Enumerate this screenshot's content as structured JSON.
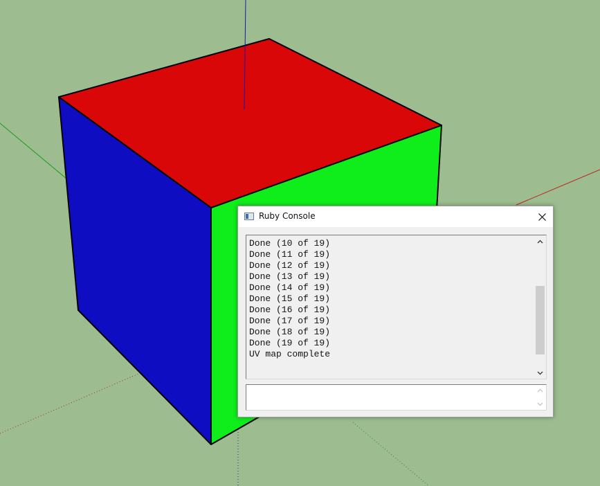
{
  "viewport": {
    "background": "#9dbd90",
    "cube_faces": {
      "top": "#d90707",
      "left": "#0f0dc2",
      "right": "#0fee1a"
    },
    "axes": {
      "x": "#c02020",
      "y": "#1a9a1a",
      "z": "#1a1aa8"
    }
  },
  "console": {
    "title": "Ruby Console",
    "icon": "ruby-console-window-icon",
    "close_icon": "close-x-icon",
    "output_lines": [
      "Done (10 of 19)",
      "Done (11 of 19)",
      "Done (12 of 19)",
      "Done (13 of 19)",
      "Done (14 of 19)",
      "Done (15 of 19)",
      "Done (16 of 19)",
      "Done (17 of 19)",
      "Done (18 of 19)",
      "Done (19 of 19)",
      "UV map complete"
    ],
    "scroll_position": 0.75,
    "input_value": ""
  }
}
